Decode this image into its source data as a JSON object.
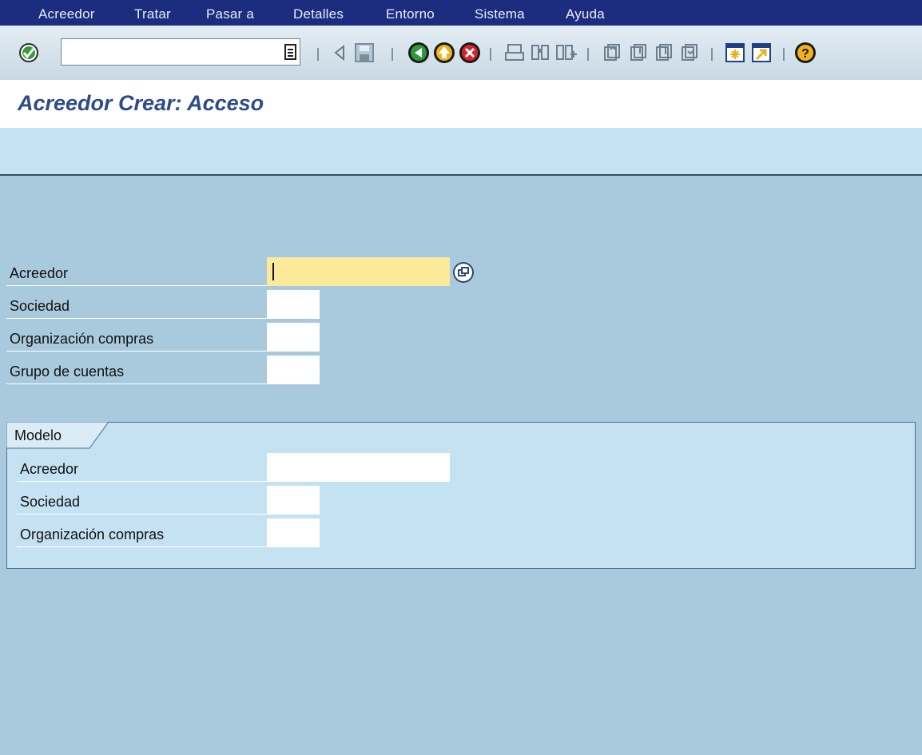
{
  "menu": {
    "items": [
      "Acreedor",
      "Tratar",
      "Pasar a",
      "Detalles",
      "Entorno",
      "Sistema",
      "Ayuda"
    ]
  },
  "toolbar": {
    "command_field_value": "",
    "icons": [
      "enter-check-icon",
      "command-history-icon",
      "back-triangle-icon",
      "save-icon",
      "back-icon",
      "exit-icon",
      "cancel-icon",
      "print-icon",
      "find-icon",
      "find-next-icon",
      "first-page-icon",
      "previous-page-icon",
      "next-page-icon",
      "last-page-icon",
      "new-session-icon",
      "create-shortcut-icon",
      "help-icon"
    ]
  },
  "page": {
    "title": "Acreedor Crear: Acceso"
  },
  "form": {
    "acreedor_label": "Acreedor",
    "acreedor_value": "",
    "sociedad_label": "Sociedad",
    "sociedad_value": "",
    "org_compras_label": "Organización compras",
    "org_compras_value": "",
    "grupo_cuentas_label": "Grupo de cuentas",
    "grupo_cuentas_value": ""
  },
  "modelo": {
    "title": "Modelo",
    "acreedor_label": "Acreedor",
    "acreedor_value": "",
    "sociedad_label": "Sociedad",
    "sociedad_value": "",
    "org_compras_label": "Organización compras",
    "org_compras_value": ""
  },
  "colors": {
    "menubar": "#1c2c7e",
    "background": "#a9c9dd",
    "title": "#2e4b8a",
    "required_field": "#fde99a"
  }
}
